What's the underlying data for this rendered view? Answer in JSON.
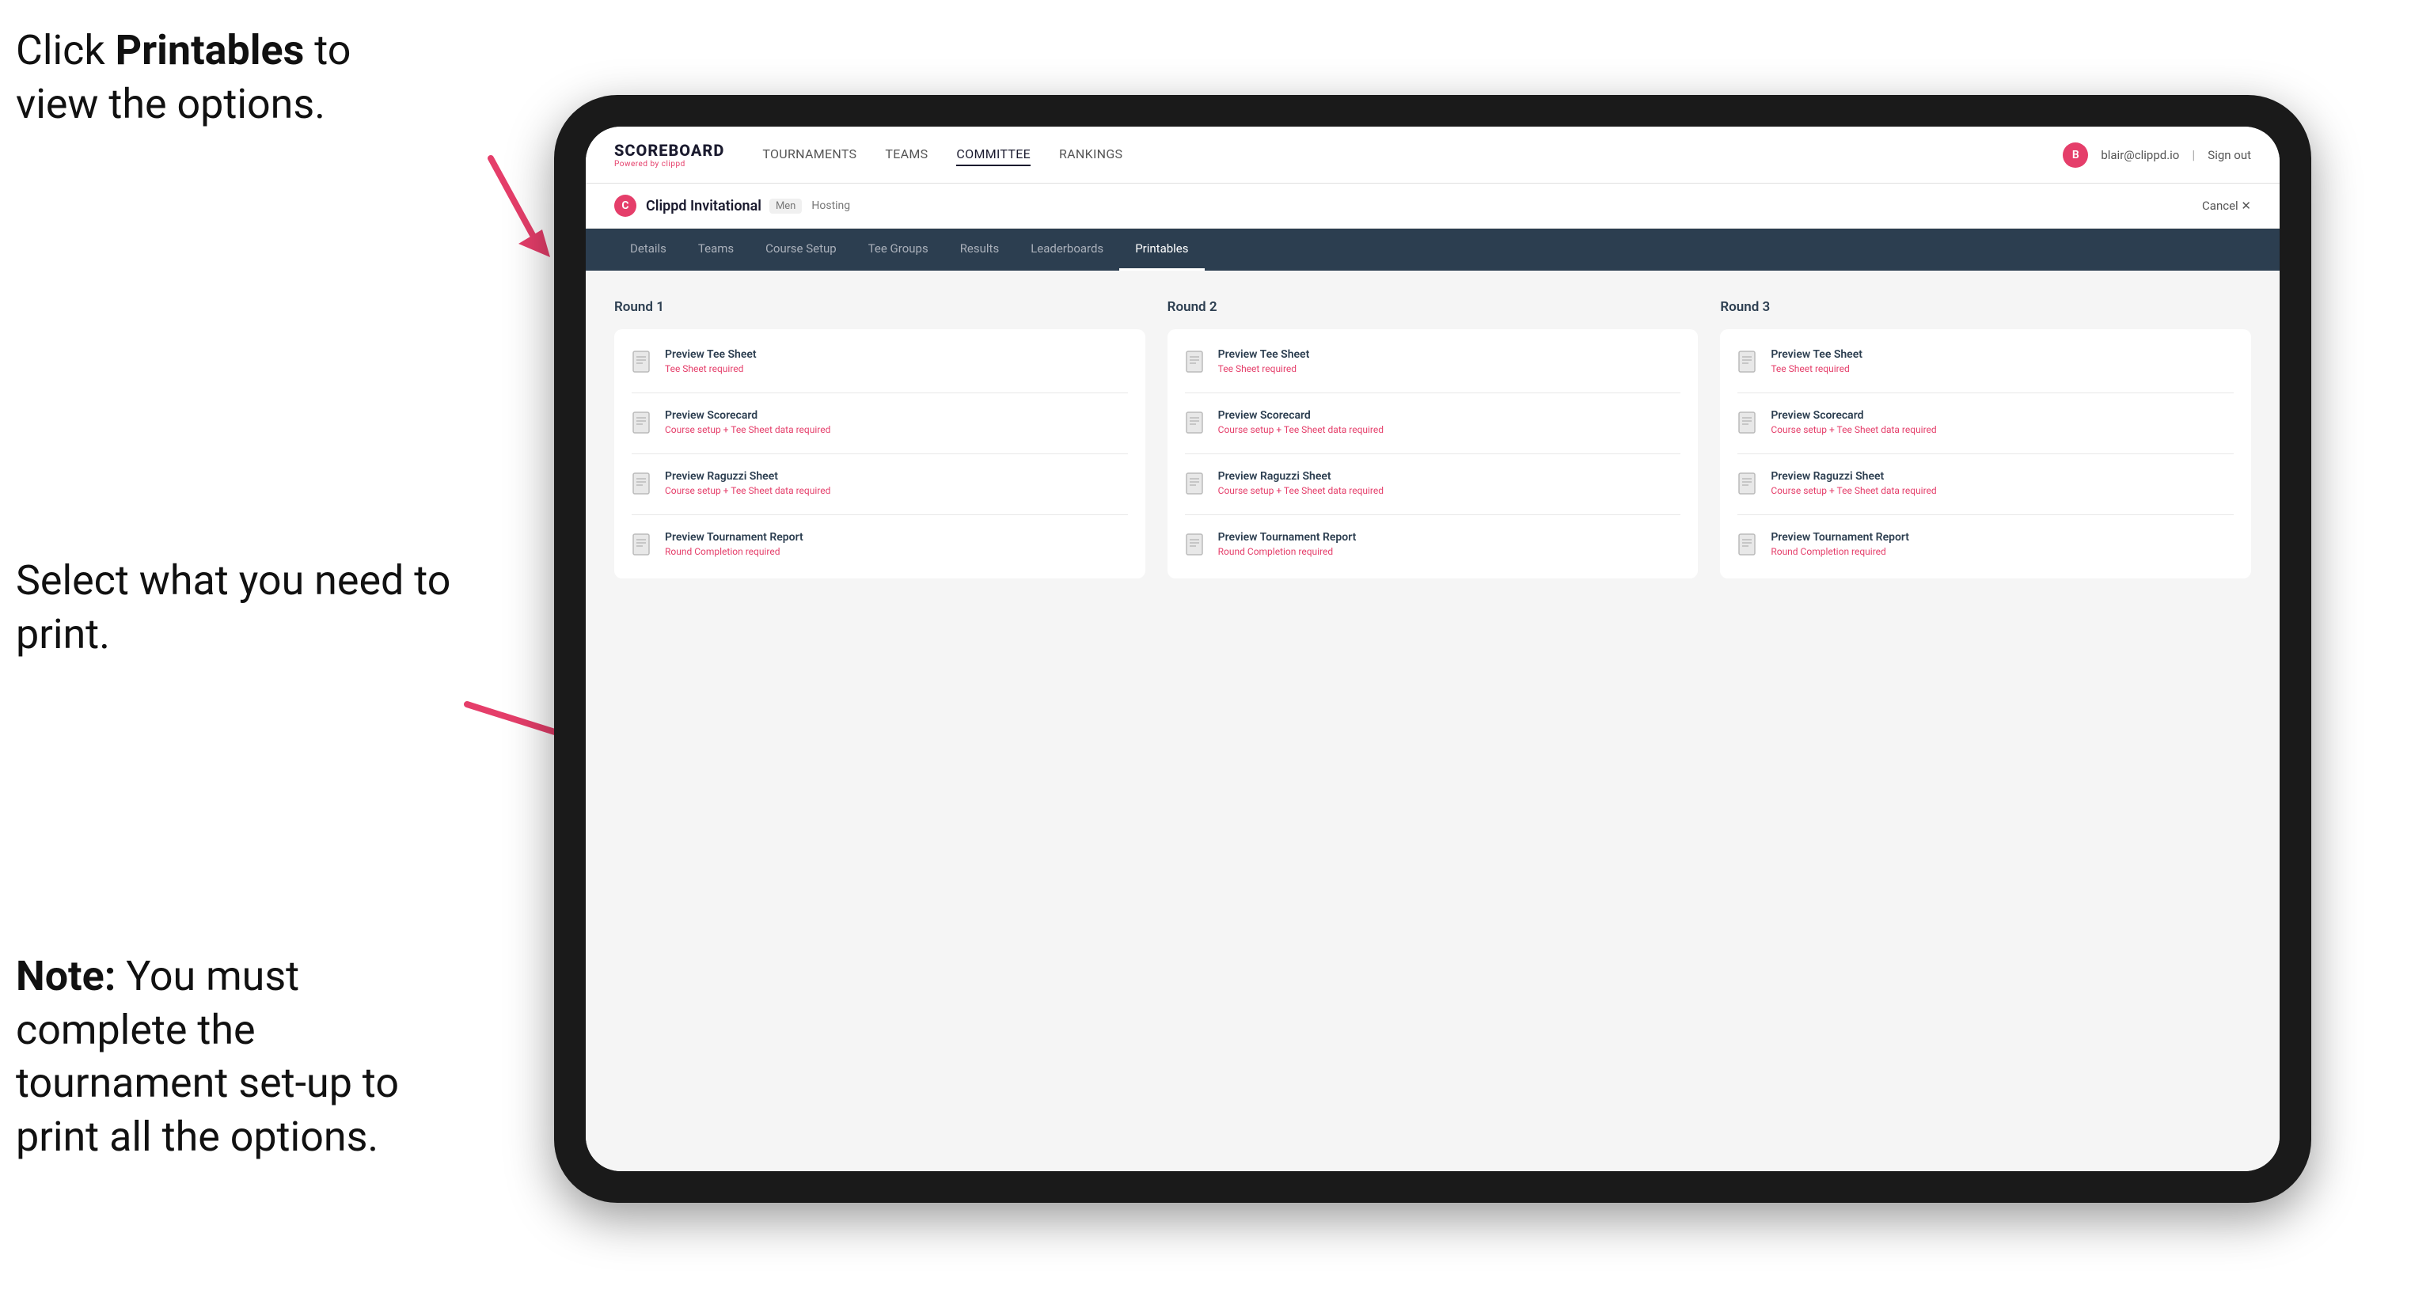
{
  "instructions": {
    "top": {
      "line1": "Click ",
      "bold": "Printables",
      "line2": " to",
      "line3": "view the options."
    },
    "middle": {
      "text": "Select what you need to print."
    },
    "bottom": {
      "bold": "Note:",
      "text": " You must complete the tournament set-up to print all the options."
    }
  },
  "topNav": {
    "logo": "SCOREBOARD",
    "logoSub": "Powered by clippd",
    "links": [
      "TOURNAMENTS",
      "TEAMS",
      "COMMITTEE",
      "RANKINGS"
    ],
    "userEmail": "blair@clippd.io",
    "signOut": "Sign out"
  },
  "tournamentHeader": {
    "logoLetter": "C",
    "name": "Clippd Invitational",
    "badge": "Men",
    "status": "Hosting",
    "cancel": "Cancel ✕"
  },
  "subNav": {
    "tabs": [
      "Details",
      "Teams",
      "Course Setup",
      "Tee Groups",
      "Results",
      "Leaderboards",
      "Printables"
    ],
    "active": "Printables"
  },
  "rounds": [
    {
      "title": "Round 1",
      "options": [
        {
          "title": "Preview Tee Sheet",
          "subtitle": "Tee Sheet required"
        },
        {
          "title": "Preview Scorecard",
          "subtitle": "Course setup + Tee Sheet data required"
        },
        {
          "title": "Preview Raguzzi Sheet",
          "subtitle": "Course setup + Tee Sheet data required"
        },
        {
          "title": "Preview Tournament Report",
          "subtitle": "Round Completion required"
        }
      ]
    },
    {
      "title": "Round 2",
      "options": [
        {
          "title": "Preview Tee Sheet",
          "subtitle": "Tee Sheet required"
        },
        {
          "title": "Preview Scorecard",
          "subtitle": "Course setup + Tee Sheet data required"
        },
        {
          "title": "Preview Raguzzi Sheet",
          "subtitle": "Course setup + Tee Sheet data required"
        },
        {
          "title": "Preview Tournament Report",
          "subtitle": "Round Completion required"
        }
      ]
    },
    {
      "title": "Round 3",
      "options": [
        {
          "title": "Preview Tee Sheet",
          "subtitle": "Tee Sheet required"
        },
        {
          "title": "Preview Scorecard",
          "subtitle": "Course setup + Tee Sheet data required"
        },
        {
          "title": "Preview Raguzzi Sheet",
          "subtitle": "Course setup + Tee Sheet data required"
        },
        {
          "title": "Preview Tournament Report",
          "subtitle": "Round Completion required"
        }
      ]
    }
  ],
  "colors": {
    "brand": "#e53e6a",
    "navBg": "#2c3e50",
    "text": "#2c3e50"
  }
}
